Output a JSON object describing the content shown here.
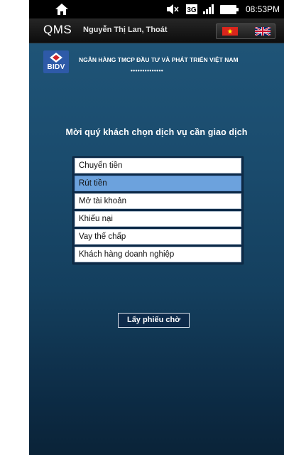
{
  "statusbar": {
    "time": "08:53PM",
    "icons": [
      "home-icon",
      "volume-mute-icon",
      "3g-icon",
      "signal-icon",
      "battery-icon"
    ]
  },
  "header": {
    "app_name": "QMS",
    "user_info": "Nguyễn Thị Lan, Thoát",
    "languages": [
      "vietnam-flag-icon",
      "uk-flag-icon"
    ]
  },
  "bank": {
    "logo_text": "BIDV",
    "name": "NGÂN HÀNG TMCP ĐẦU TƯ VÀ PHÁT TRIỂN VIỆT NAM",
    "decoration": "••••••••••••••"
  },
  "main": {
    "prompt": "Mời quý khách chọn dịch vụ cần giao dịch",
    "services": [
      {
        "label": "Chuyển tiền",
        "selected": false
      },
      {
        "label": "Rút tiền",
        "selected": true
      },
      {
        "label": "Mở tài khoản",
        "selected": false
      },
      {
        "label": "Khiếu nại",
        "selected": false
      },
      {
        "label": "Vay thế chấp",
        "selected": false
      },
      {
        "label": "Khách hàng doanh nghiệp",
        "selected": false
      }
    ],
    "ticket_button": "Lấy phiếu chờ"
  },
  "colors": {
    "selected_item": "#6ca2dd",
    "background_top": "#1f5477",
    "background_bottom": "#0a2338",
    "logo_blue": "#2e5aa8",
    "logo_red": "#d2232a"
  }
}
